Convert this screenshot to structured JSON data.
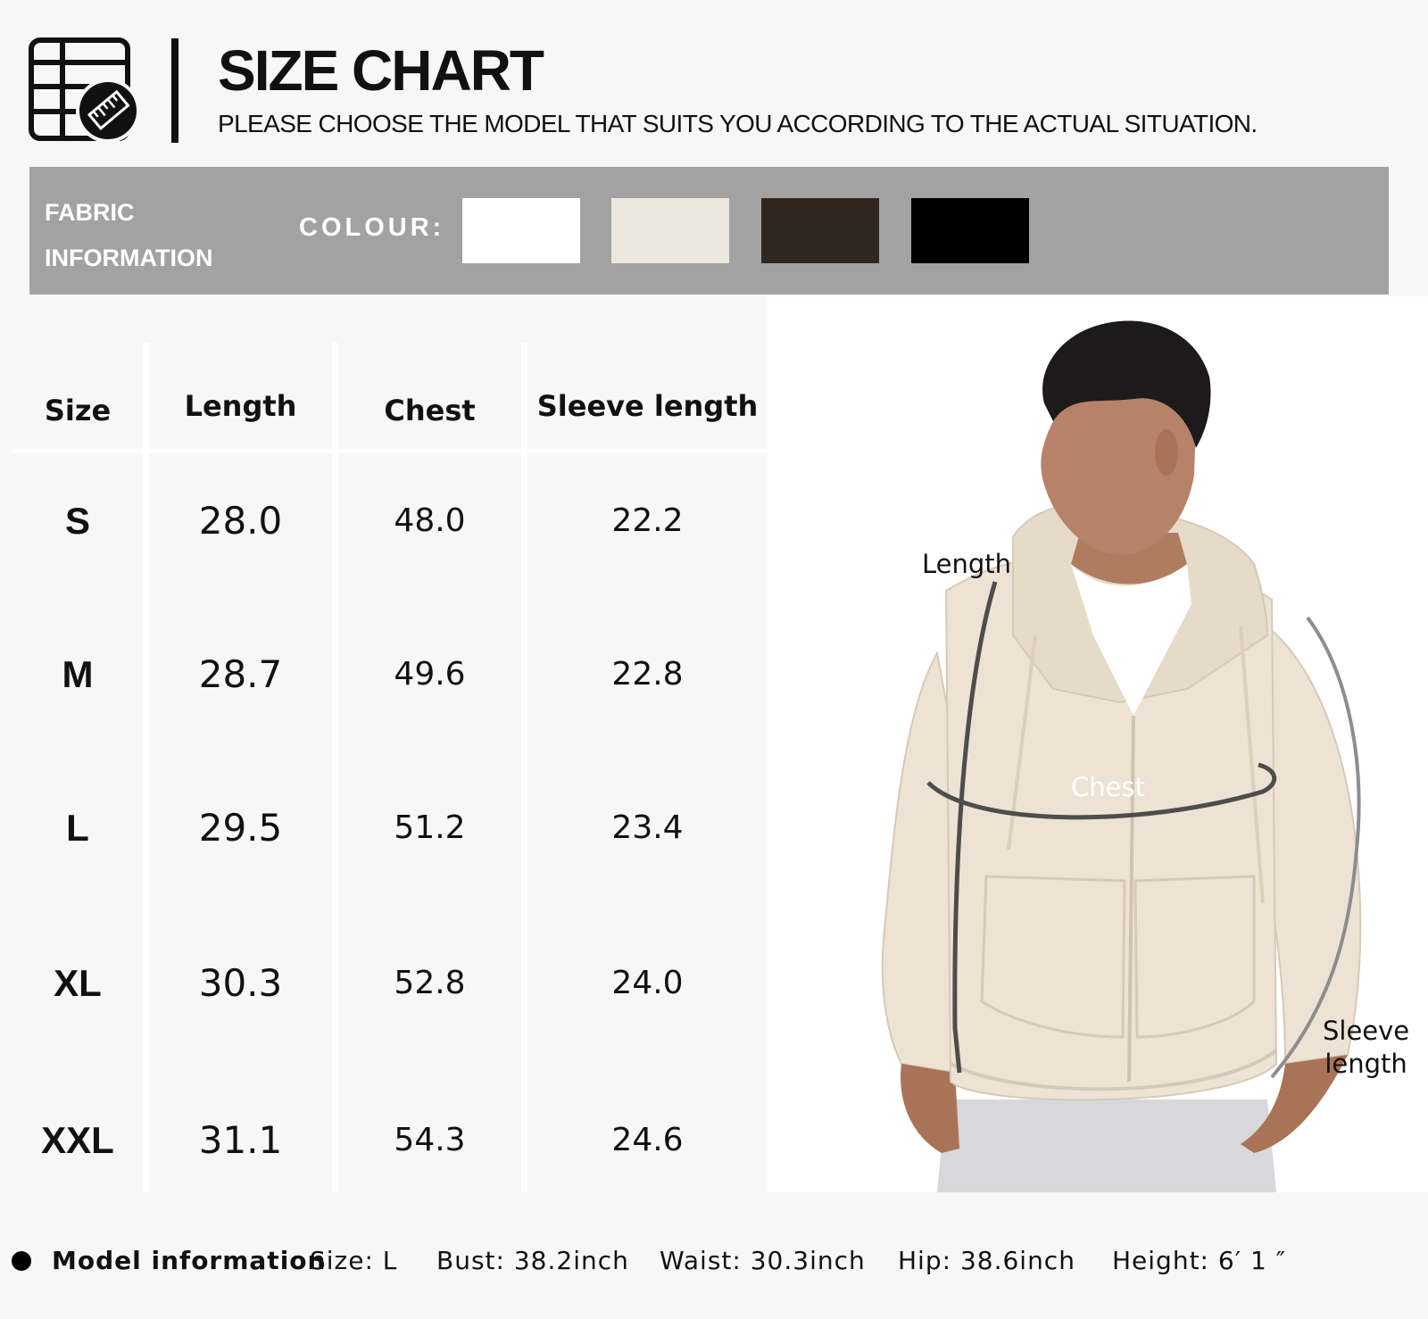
{
  "header": {
    "title": "SIZE CHART",
    "subtitle": "PLEASE CHOOSE THE MODEL THAT SUITS YOU ACCORDING TO THE ACTUAL SITUATION."
  },
  "fabric": {
    "label_line1": "FABRIC",
    "label_line2": "INFORMATION",
    "colour_label": "COLOUR:",
    "colours": [
      "#ffffff",
      "#ece6df",
      "#302820",
      "#000000"
    ]
  },
  "table": {
    "headers": [
      "Size",
      "Length",
      "Chest",
      "Sleeve length"
    ],
    "rows": [
      [
        "S",
        "28.0",
        "48.0",
        "22.2"
      ],
      [
        "M",
        "28.7",
        "49.6",
        "22.8"
      ],
      [
        "L",
        "29.5",
        "51.2",
        "23.4"
      ],
      [
        "XL",
        "30.3",
        "52.8",
        "24.0"
      ],
      [
        "XXL",
        "31.1",
        "54.3",
        "24.6"
      ]
    ]
  },
  "photo": {
    "length_label": "Length",
    "chest_label": "Chest",
    "sleeve_label_line1": "Sleeve",
    "sleeve_label_line2": "length",
    "hoodie_color": "#ede3d4"
  },
  "model_info": {
    "title": "Model information",
    "size": "Size:  L",
    "bust": "Bust:  38.2inch",
    "waist": "Waist:  30.3inch",
    "hip": "Hip:  38.6inch",
    "height": "Height:  6′ 1 ″"
  },
  "icons": [
    "size-chart-table-icon",
    "ruler-icon"
  ]
}
